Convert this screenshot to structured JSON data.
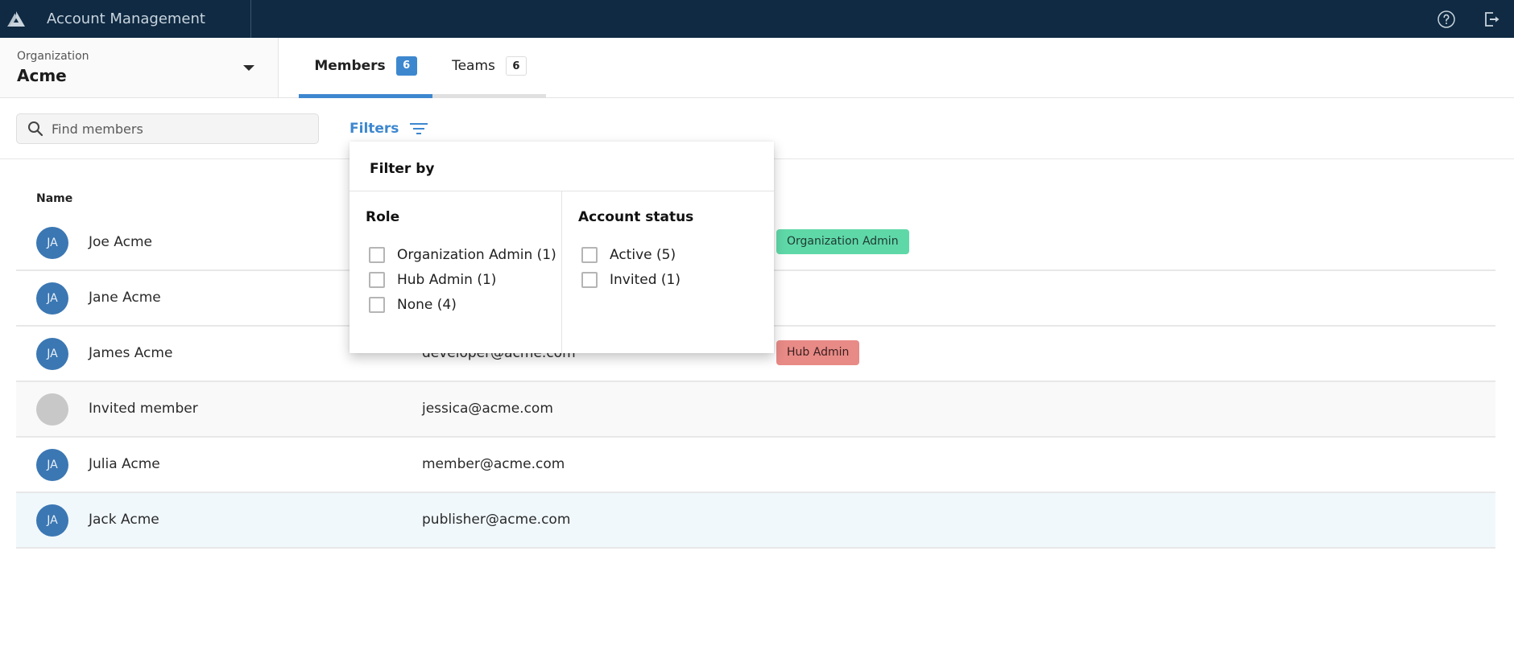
{
  "header": {
    "app_title": "Account Management",
    "logo_icon": "triangle-logo-icon",
    "help_icon": "help-circle-icon",
    "logout_icon": "logout-icon"
  },
  "organization": {
    "label": "Organization",
    "value": "Acme"
  },
  "tabs": [
    {
      "label": "Members",
      "count": "6",
      "active": true
    },
    {
      "label": "Teams",
      "count": "6",
      "active": false
    }
  ],
  "toolbar": {
    "search_placeholder": "Find members",
    "search_value": "",
    "filters_label": "Filters"
  },
  "table": {
    "columns": [
      "Name"
    ],
    "rows": [
      {
        "initials": "JA",
        "name": "Joe Acme",
        "email": "",
        "role_badge": "Organization Admin"
      },
      {
        "initials": "JA",
        "name": "Jane Acme",
        "email": "",
        "role_badge": ""
      },
      {
        "initials": "JA",
        "name": "James Acme",
        "email": "developer@acme.com",
        "role_badge": "Hub Admin"
      },
      {
        "initials": "",
        "name": "Invited member",
        "email": "jessica@acme.com",
        "role_badge": ""
      },
      {
        "initials": "JA",
        "name": "Julia Acme",
        "email": "member@acme.com",
        "role_badge": ""
      },
      {
        "initials": "JA",
        "name": "Jack Acme",
        "email": "publisher@acme.com",
        "role_badge": ""
      }
    ]
  },
  "filter_popover": {
    "title": "Filter by",
    "role": {
      "title": "Role",
      "options": [
        {
          "label": "Organization Admin (1)",
          "checked": false
        },
        {
          "label": "Hub Admin (1)",
          "checked": false
        },
        {
          "label": "None (4)",
          "checked": false
        }
      ]
    },
    "account_status": {
      "title": "Account status",
      "options": [
        {
          "label": "Active (5)",
          "checked": false
        },
        {
          "label": "Invited (1)",
          "checked": false
        }
      ]
    }
  },
  "colors": {
    "topbar": "#0f2a42",
    "accent": "#3d87cf",
    "avatar": "#3b77b3",
    "org_admin_badge": "#5fd8a8",
    "hub_admin_badge": "#e88a86",
    "row_hover": "#f0f8fc"
  }
}
